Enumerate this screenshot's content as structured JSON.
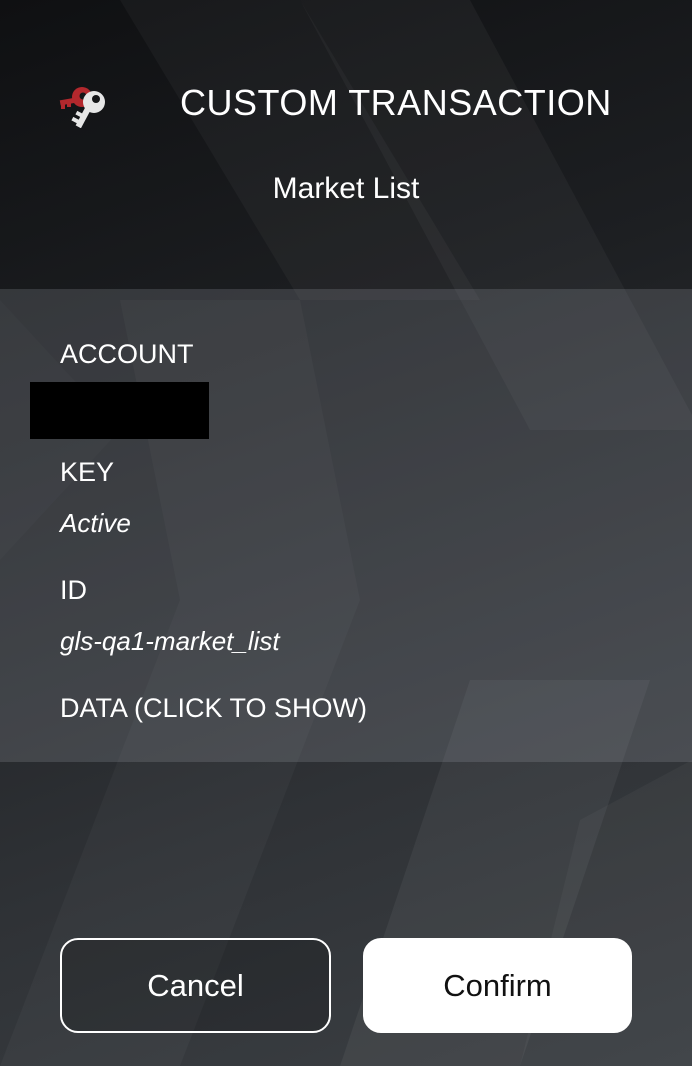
{
  "header": {
    "logo_icon": "key-icon",
    "title": "CUSTOM TRANSACTION",
    "subtitle": "Market List"
  },
  "details": {
    "account_label": "ACCOUNT",
    "account_value_redacted": true,
    "key_label": "KEY",
    "key_value": "Active",
    "id_label": "ID",
    "id_value": "gls-qa1-market_list",
    "data_label": "DATA (CLICK TO SHOW)"
  },
  "actions": {
    "cancel_label": "Cancel",
    "confirm_label": "Confirm"
  },
  "colors": {
    "accent_red": "#b3282d",
    "background_dark": "#141517",
    "button_primary_bg": "#ffffff",
    "button_primary_text": "#111111"
  }
}
